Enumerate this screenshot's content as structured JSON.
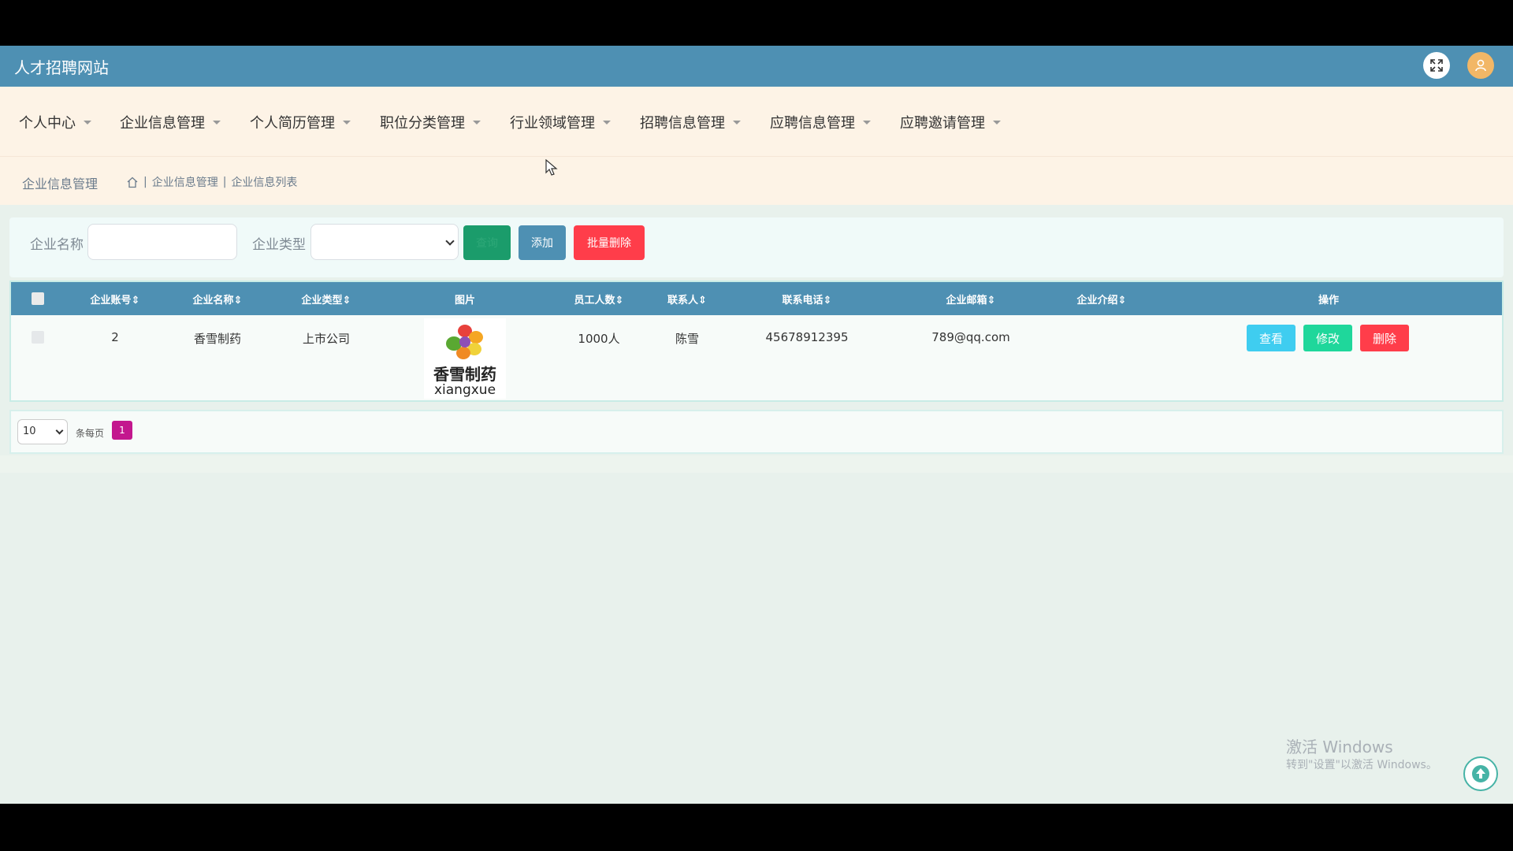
{
  "header": {
    "site_title": "人才招聘网站",
    "expand_icon": "expand-icon",
    "user_icon": "user-icon"
  },
  "menu": {
    "items": [
      {
        "label": "个人中心"
      },
      {
        "label": "企业信息管理"
      },
      {
        "label": "个人简历管理"
      },
      {
        "label": "职位分类管理"
      },
      {
        "label": "行业领域管理"
      },
      {
        "label": "招聘信息管理"
      },
      {
        "label": "应聘信息管理"
      },
      {
        "label": "应聘邀请管理"
      }
    ]
  },
  "breadcrumb": {
    "title": "企业信息管理",
    "crumb1": "企业信息管理",
    "crumb2": "企业信息列表",
    "sep": "|"
  },
  "search": {
    "name_label": "企业名称",
    "name_value": "",
    "type_label": "企业类型",
    "type_value": "",
    "search_button": "查询",
    "add_button": "添加",
    "batch_delete_button": "批量删除"
  },
  "table": {
    "headers": [
      "企业账号",
      "企业名称",
      "企业类型",
      "图片",
      "员工人数",
      "联系人",
      "联系电话",
      "企业邮箱",
      "企业介绍",
      "操作"
    ],
    "rows": [
      {
        "account": "2",
        "name": "香雪制药",
        "type": "上市公司",
        "logo_cn": "香雪制药",
        "logo_en": "xiangxue",
        "employees": "1000人",
        "contact": "陈雪",
        "phone": "45678912395",
        "email": "789@qq.com",
        "intro": "",
        "view_label": "查看",
        "edit_label": "修改",
        "delete_label": "删除"
      }
    ]
  },
  "pagination": {
    "page_size": "10",
    "per_page_label": "条每页",
    "current_page": "1"
  },
  "watermark": {
    "line1": "激活 Windows",
    "line2": "转到\"设置\"以激活 Windows。"
  },
  "colors": {
    "header": "#4e90b3",
    "menu_bg": "#fdf3e6",
    "accent_pink": "#c3178e",
    "danger": "#ff3d4a"
  }
}
